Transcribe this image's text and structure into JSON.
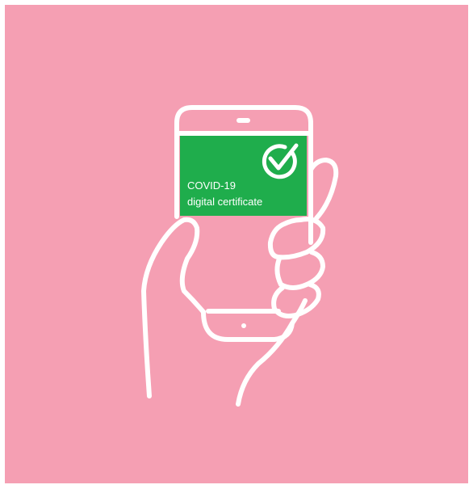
{
  "colors": {
    "background": "#f59fb3",
    "frame": "#ffffff",
    "screen_card": "#1fad4c",
    "line": "#ffffff"
  },
  "icons": {
    "check": "check-circle-icon",
    "hand": "hand-icon",
    "phone": "smartphone-icon"
  },
  "certificate": {
    "line1": "COVID-19",
    "line2": "digital certificate"
  }
}
